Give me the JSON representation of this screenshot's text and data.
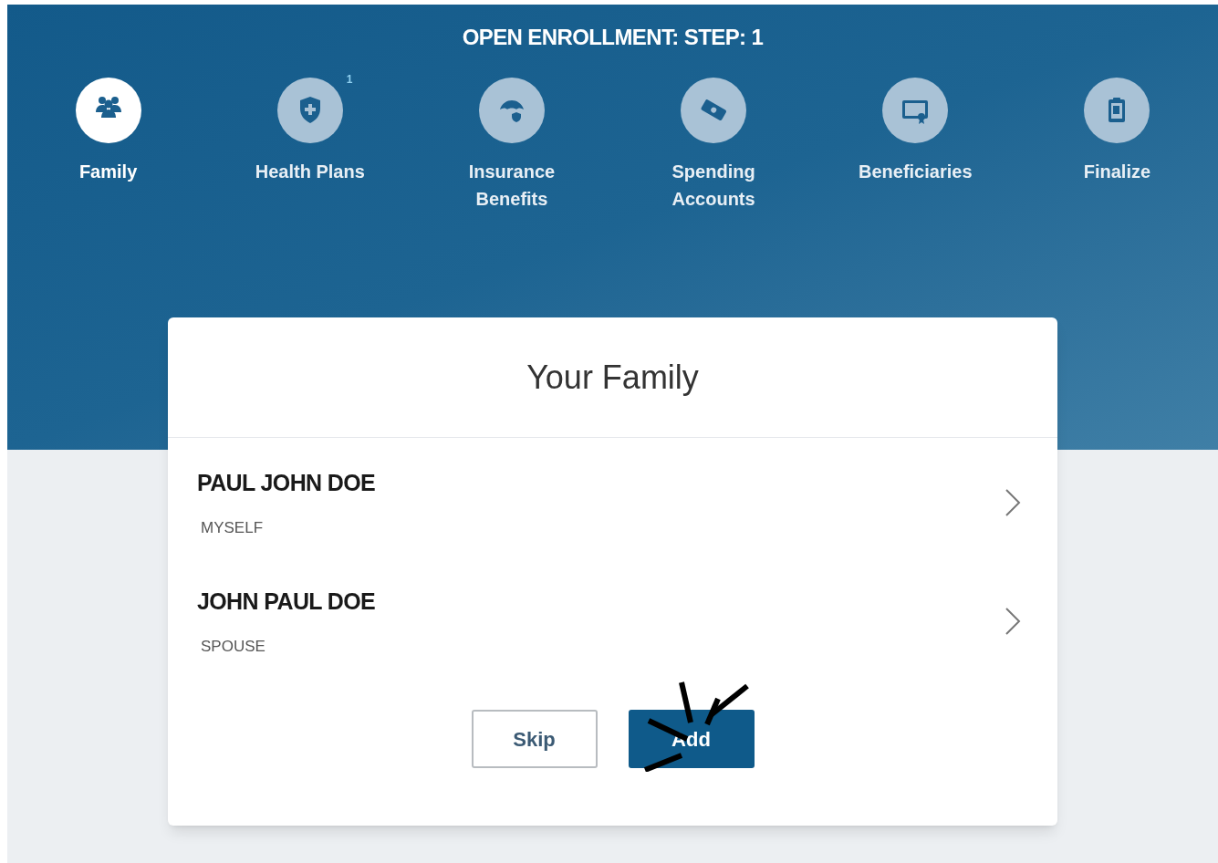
{
  "header": {
    "title": "OPEN ENROLLMENT: STEP: 1"
  },
  "steps": [
    {
      "kind": "family",
      "label": "Family",
      "selected": true
    },
    {
      "kind": "health",
      "label": "Health Plans",
      "selected": false,
      "badge": "1"
    },
    {
      "kind": "insurance",
      "label": "Insurance Benefits",
      "selected": false
    },
    {
      "kind": "spending",
      "label": "Spending Accounts",
      "selected": false
    },
    {
      "kind": "beneficiaries",
      "label": "Beneficiaries",
      "selected": false
    },
    {
      "kind": "finalize",
      "label": "Finalize",
      "selected": false
    }
  ],
  "card": {
    "title": "Your Family",
    "members": [
      {
        "name": "PAUL JOHN DOE",
        "relation": "MYSELF"
      },
      {
        "name": "JOHN PAUL DOE",
        "relation": "SPOUSE"
      }
    ],
    "buttons": [
      {
        "label": "Skip",
        "kind": "secondary"
      },
      {
        "label": "Add",
        "kind": "primary"
      }
    ]
  }
}
